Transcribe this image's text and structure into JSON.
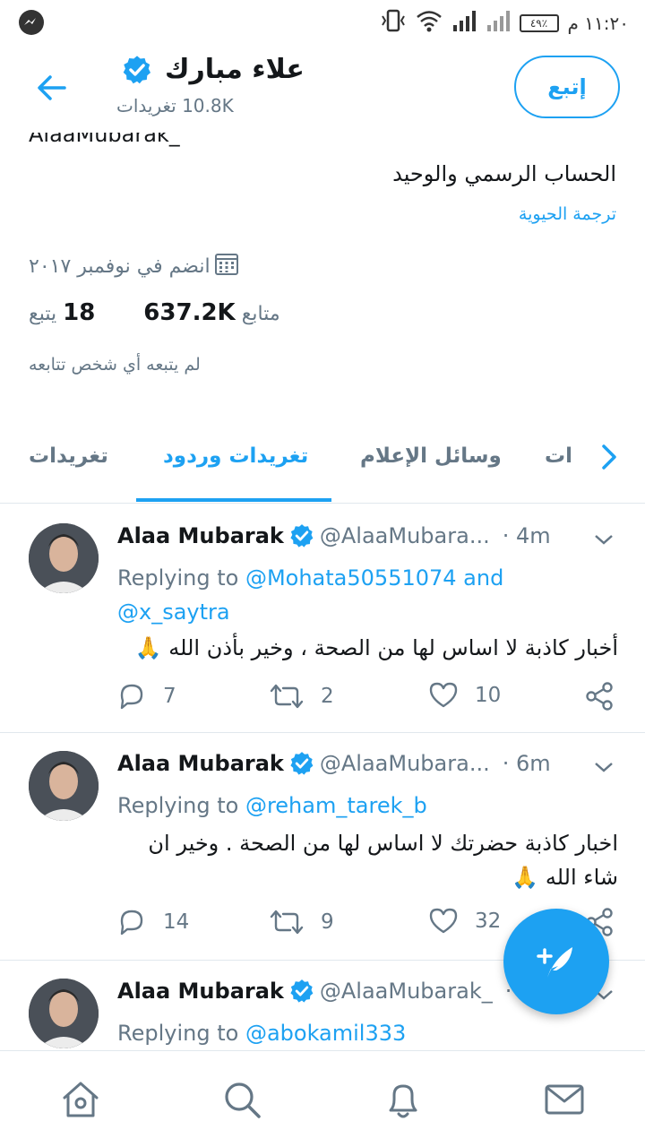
{
  "status_bar": {
    "time": "١١:٢٠ م",
    "battery": "٤٩٪"
  },
  "header": {
    "name": "علاء مبارك",
    "tweet_count": "10.8K تغريدات",
    "follow_label": "إتبع"
  },
  "profile": {
    "handle_partial": "AlaaMubarak_",
    "bio": "الحساب الرسمي والوحيد",
    "translate_bio": "ترجمة الحيوية",
    "joined": "انضم في نوفمبر ٢٠١٧",
    "followers_label": "متابع",
    "followers_count": "637.2K",
    "following_count": "18",
    "following_label": "يتبع",
    "not_followed": "لم يتبعه أي شخص تتابعه"
  },
  "tabs": {
    "partial": "ات",
    "media": "وسائل الإعلام",
    "tweets_replies": "تغريدات وردود",
    "tweets": "تغريدات"
  },
  "tweets": [
    {
      "name": "Alaa Mubarak",
      "handle": "@AlaaMubara...",
      "time": "· 4m",
      "replying_prefix": "Replying to",
      "replying_mentions": "@Mohata50551074 and @x_saytra",
      "text": "أخبار كاذبة لا اساس لها من الصحة ، وخير بأذن الله 🙏",
      "replies": "7",
      "retweets": "2",
      "likes": "10"
    },
    {
      "name": "Alaa Mubarak",
      "handle": "@AlaaMubara...",
      "time": "· 6m",
      "replying_prefix": "Replying to",
      "replying_mentions": "@reham_tarek_b",
      "text": "اخبار كاذبة حضرتك لا اساس لها من الصحة . وخير ان شاء الله 🙏",
      "replies": "14",
      "retweets": "9",
      "likes": "32"
    },
    {
      "name": "Alaa Mubarak",
      "handle": "@AlaaMubarak_",
      "time": "·",
      "replying_prefix": "Replying to",
      "replying_mentions": "@abokamil333"
    }
  ],
  "colors": {
    "accent": "#1da1f2",
    "secondary_text": "#657786",
    "primary_text": "#14171a"
  }
}
